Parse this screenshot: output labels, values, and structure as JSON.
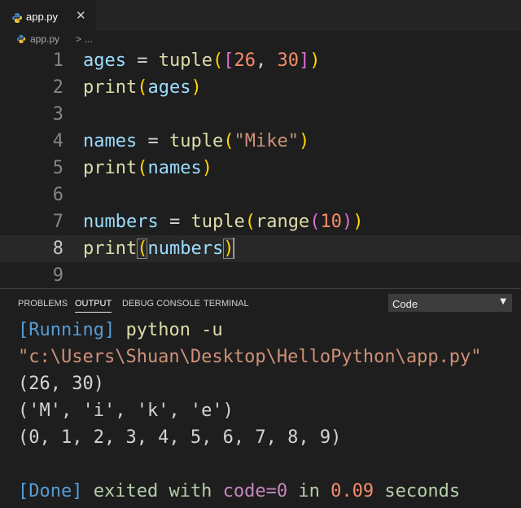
{
  "tabs": [
    {
      "label": "app.py",
      "close_glyph": "✕",
      "icon": "python-icon"
    }
  ],
  "breadcrumb": {
    "file": "app.py",
    "separator": ">",
    "more": "..."
  },
  "editor": {
    "current_line": 8,
    "lines": [
      {
        "number": "1",
        "text": "ages = tuple([26, 30])"
      },
      {
        "number": "2",
        "text": "print(ages)"
      },
      {
        "number": "3",
        "text": ""
      },
      {
        "number": "4",
        "text": "names = tuple(\"Mike\")"
      },
      {
        "number": "5",
        "text": "print(names)"
      },
      {
        "number": "6",
        "text": ""
      },
      {
        "number": "7",
        "text": "numbers = tuple(range(10))"
      },
      {
        "number": "8",
        "text": "print(numbers)"
      },
      {
        "number": "9",
        "text": ""
      }
    ]
  },
  "panel": {
    "tabs": [
      "PROBLEMS",
      "OUTPUT",
      "DEBUG CONSOLE",
      "TERMINAL"
    ],
    "active_tab": "OUTPUT",
    "channel_select": {
      "value": "Code",
      "arrow": "▼"
    },
    "output": {
      "running_tag": "[Running]",
      "command": "python -u",
      "path": "\"c:\\Users\\Shuan\\Desktop\\HelloPython\\app.py\"",
      "results": [
        "(26, 30)",
        "('M', 'i', 'k', 'e')",
        "(0, 1, 2, 3, 4, 5, 6, 7, 8, 9)"
      ],
      "done_tag": "[Done]",
      "exited_with": "exited with",
      "code_label": "code=0",
      "in_word": "in",
      "duration": "0.09",
      "seconds_word": "seconds"
    }
  },
  "colors": {
    "background": "#1e1e1e",
    "keyword_fn": "#dcdcaa",
    "variable": "#9cdcfe",
    "number": "#f78c6c",
    "string": "#ce9178",
    "output_tag": "#569cd6"
  }
}
